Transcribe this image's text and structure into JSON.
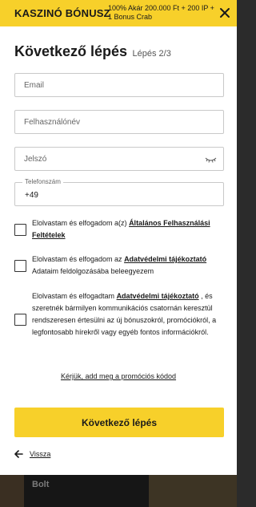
{
  "bonus_bar": {
    "title": "KASZINÓ BÓNUSZ",
    "offer_line1": "100% Akár 200.000 Ft + 200 IP +",
    "offer_line2": "1 Bonus Crab"
  },
  "heading": {
    "title": "Következő lépés",
    "step": "Lépés 2/3"
  },
  "fields": {
    "email_placeholder": "Email",
    "username_placeholder": "Felhasználónév",
    "password_placeholder": "Jelszó",
    "phone_label": "Telefonszám",
    "phone_value": "+49"
  },
  "consents": [
    {
      "text": "Elolvastam és elfogadom a(z) ",
      "link": "Általános Felhasználási Feltételek",
      "tail": ""
    },
    {
      "text": "Elolvastam és elfogadom az ",
      "link": "Adatvédelmi tájékoztató",
      "tail": " Adataim feldolgozásába beleegyezem"
    },
    {
      "text": "Elolvastam és elfogadtam ",
      "link": "Adatvédelmi tájékoztató",
      "tail": " , és szeretnék bármilyen kommunikációs csatornán keresztül rendszeresen értesülni az új bónuszokról, promóciókról, a legfontosabb hírekről vagy egyéb fontos információkról."
    }
  ],
  "promo_link": "Kérjük, add meg a promóciós kódod",
  "next_button": "Következő lépés",
  "back_link": "Vissza",
  "footer": {
    "nav_item": "Bolt"
  },
  "colors": {
    "accent": "#f7d02a",
    "text": "#1a1a1a",
    "border": "#c9c9c9"
  },
  "icons": [
    "close-icon",
    "eye-icon",
    "back-arrow-icon"
  ]
}
